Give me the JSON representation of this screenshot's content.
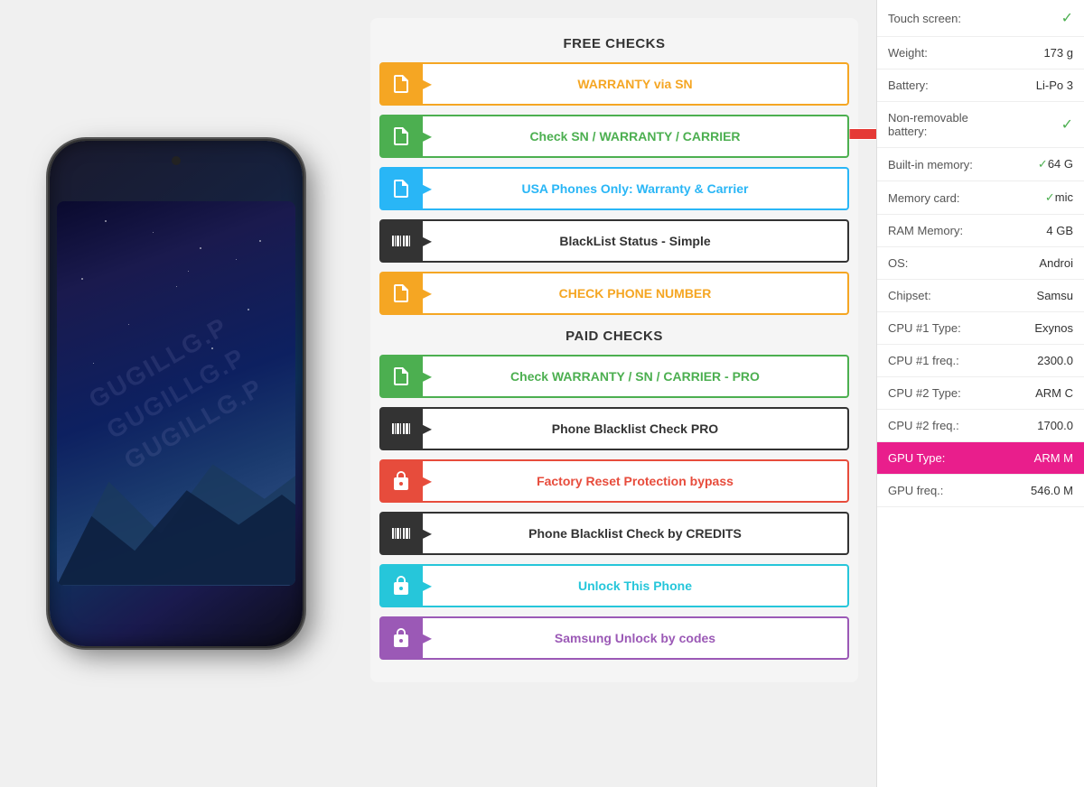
{
  "free_checks_title": "FREE CHECKS",
  "paid_checks_title": "PAID CHECKS",
  "buttons": [
    {
      "id": "warranty-sn",
      "label": "WARRANTY via SN",
      "type": "free",
      "icon": "doc",
      "colorClass": "btn-warranty-sn"
    },
    {
      "id": "check-sn",
      "label": "Check SN / WARRANTY / CARRIER",
      "type": "free",
      "icon": "doc",
      "colorClass": "btn-check-sn",
      "hasArrow": true
    },
    {
      "id": "usa",
      "label": "USA Phones Only: Warranty & Carrier",
      "type": "free",
      "icon": "doc",
      "colorClass": "btn-usa"
    },
    {
      "id": "blacklist-simple",
      "label": "BlackList Status - Simple",
      "type": "free",
      "icon": "barcode",
      "colorClass": "btn-blacklist-simple"
    },
    {
      "id": "check-phone",
      "label": "CHECK PHONE NUMBER",
      "type": "free",
      "icon": "doc",
      "colorClass": "btn-check-phone"
    },
    {
      "id": "warranty-pro",
      "label": "Check WARRANTY / SN / CARRIER - PRO",
      "type": "paid",
      "icon": "doc",
      "colorClass": "btn-warranty-pro"
    },
    {
      "id": "blacklist-pro",
      "label": "Phone Blacklist Check PRO",
      "type": "paid",
      "icon": "barcode",
      "colorClass": "btn-blacklist-pro"
    },
    {
      "id": "frp",
      "label": "Factory Reset Protection bypass",
      "type": "paid",
      "icon": "lock",
      "colorClass": "btn-frp"
    },
    {
      "id": "blacklist-credits",
      "label": "Phone Blacklist Check by CREDITS",
      "type": "paid",
      "icon": "barcode",
      "colorClass": "btn-blacklist-credits"
    },
    {
      "id": "unlock",
      "label": "Unlock This Phone",
      "type": "paid",
      "icon": "lock",
      "colorClass": "btn-unlock"
    },
    {
      "id": "samsung-unlock",
      "label": "Samsung Unlock by codes",
      "type": "paid",
      "icon": "lock",
      "colorClass": "btn-samsung-unlock"
    }
  ],
  "specs": [
    {
      "label": "Touch screen:",
      "value": "✓",
      "isCheck": true,
      "highlighted": false
    },
    {
      "label": "Weight:",
      "value": "173 g",
      "isCheck": false,
      "highlighted": false
    },
    {
      "label": "Battery:",
      "value": "Li-Po 3",
      "isCheck": false,
      "highlighted": false
    },
    {
      "label": "Non-removable battery:",
      "value": "✓",
      "isCheck": true,
      "highlighted": false
    },
    {
      "label": "Built-in memory:",
      "value": "✓64 G",
      "isCheck": false,
      "highlighted": false
    },
    {
      "label": "Memory card:",
      "value": "✓mic",
      "isCheck": false,
      "highlighted": false
    },
    {
      "label": "RAM Memory:",
      "value": "4 GB",
      "isCheck": false,
      "highlighted": false
    },
    {
      "label": "OS:",
      "value": "Androi",
      "isCheck": false,
      "highlighted": false
    },
    {
      "label": "Chipset:",
      "value": "Samsu",
      "isCheck": false,
      "highlighted": false
    },
    {
      "label": "CPU #1 Type:",
      "value": "Exynos",
      "isCheck": false,
      "highlighted": false
    },
    {
      "label": "CPU #1 freq.:",
      "value": "2300.0",
      "isCheck": false,
      "highlighted": false
    },
    {
      "label": "CPU #2 Type:",
      "value": "ARM C",
      "isCheck": false,
      "highlighted": false
    },
    {
      "label": "CPU #2 freq.:",
      "value": "1700.0",
      "isCheck": false,
      "highlighted": false
    },
    {
      "label": "GPU Type:",
      "value": "ARM M",
      "isCheck": false,
      "highlighted": true
    },
    {
      "label": "GPU freq.:",
      "value": "546.0 M",
      "isCheck": false,
      "highlighted": false
    }
  ]
}
